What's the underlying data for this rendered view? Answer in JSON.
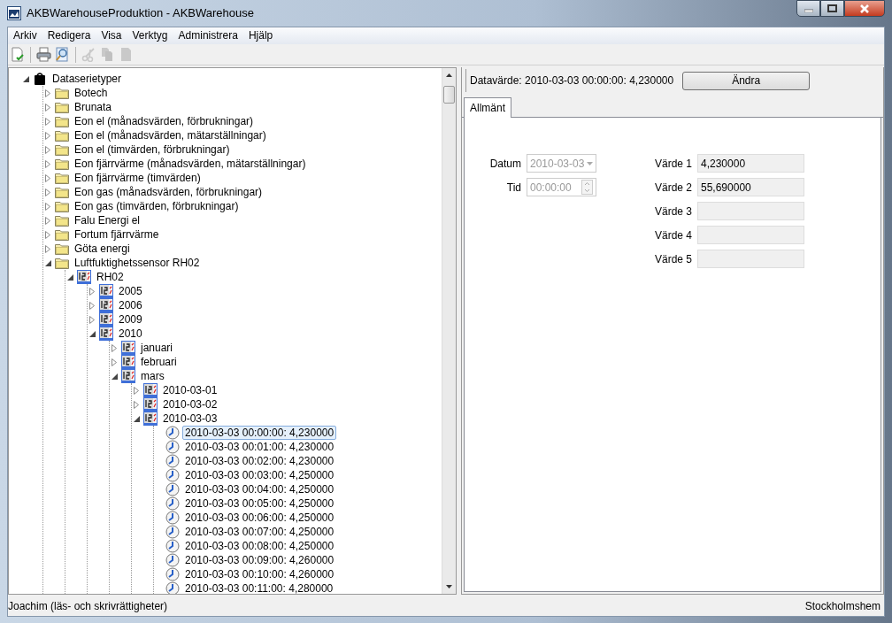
{
  "window": {
    "title": "AKBWarehouseProduktion - AKBWarehouse"
  },
  "menu": [
    "Arkiv",
    "Redigera",
    "Visa",
    "Verktyg",
    "Administrera",
    "Hjälp"
  ],
  "toolbar": [
    {
      "kind": "new",
      "disabled": false
    },
    {
      "kind": "separator"
    },
    {
      "kind": "print",
      "disabled": false
    },
    {
      "kind": "preview",
      "disabled": false
    },
    {
      "kind": "separator"
    },
    {
      "kind": "cut",
      "disabled": true
    },
    {
      "kind": "copy",
      "disabled": true
    },
    {
      "kind": "paste",
      "disabled": true
    }
  ],
  "tree": [
    {
      "label": "Dataserietyper",
      "kind": "root",
      "expanded": true,
      "selected": false,
      "children": [
        {
          "label": "Botech",
          "kind": "folder",
          "expanded": false,
          "selected": false
        },
        {
          "label": "Brunata",
          "kind": "folder",
          "expanded": false,
          "selected": false
        },
        {
          "label": "Eon el (månadsvärden, förbrukningar)",
          "kind": "folder",
          "expanded": false,
          "selected": false
        },
        {
          "label": "Eon el (månadsvärden, mätarställningar)",
          "kind": "folder",
          "expanded": false,
          "selected": false
        },
        {
          "label": "Eon el (timvärden, förbrukningar)",
          "kind": "folder",
          "expanded": false,
          "selected": false
        },
        {
          "label": "Eon fjärrvärme (månadsvärden, mätarställningar)",
          "kind": "folder",
          "expanded": false,
          "selected": false
        },
        {
          "label": "Eon fjärrvärme (timvärden)",
          "kind": "folder",
          "expanded": false,
          "selected": false
        },
        {
          "label": "Eon gas (månadsvärden, förbrukningar)",
          "kind": "folder",
          "expanded": false,
          "selected": false
        },
        {
          "label": "Eon gas (timvärden, förbrukningar)",
          "kind": "folder",
          "expanded": false,
          "selected": false
        },
        {
          "label": "Falu Energi el",
          "kind": "folder",
          "expanded": false,
          "selected": false
        },
        {
          "label": "Fortum fjärrvärme",
          "kind": "folder",
          "expanded": false,
          "selected": false
        },
        {
          "label": "Göta energi",
          "kind": "folder",
          "expanded": false,
          "selected": false
        },
        {
          "label": "Luftfuktighetssensor RH02",
          "kind": "folder",
          "expanded": true,
          "selected": false,
          "children": [
            {
              "label": "RH02",
              "kind": "series",
              "expanded": true,
              "selected": false,
              "children": [
                {
                  "label": "2005",
                  "kind": "series",
                  "expanded": false,
                  "selected": false
                },
                {
                  "label": "2006",
                  "kind": "series",
                  "expanded": false,
                  "selected": false
                },
                {
                  "label": "2009",
                  "kind": "series",
                  "expanded": false,
                  "selected": false
                },
                {
                  "label": "2010",
                  "kind": "series",
                  "expanded": true,
                  "selected": false,
                  "children": [
                    {
                      "label": "januari",
                      "kind": "series",
                      "expanded": false,
                      "selected": false
                    },
                    {
                      "label": "februari",
                      "kind": "series",
                      "expanded": false,
                      "selected": false
                    },
                    {
                      "label": "mars",
                      "kind": "series",
                      "expanded": true,
                      "selected": false,
                      "children": [
                        {
                          "label": "2010-03-01",
                          "kind": "series",
                          "expanded": false,
                          "selected": false
                        },
                        {
                          "label": "2010-03-02",
                          "kind": "series",
                          "expanded": false,
                          "selected": false
                        },
                        {
                          "label": "2010-03-03",
                          "kind": "series",
                          "expanded": true,
                          "selected": false,
                          "children": [
                            {
                              "label": "2010-03-03 00:00:00: 4,230000",
                              "kind": "value",
                              "selected": true
                            },
                            {
                              "label": "2010-03-03 00:01:00: 4,230000",
                              "kind": "value",
                              "selected": false
                            },
                            {
                              "label": "2010-03-03 00:02:00: 4,230000",
                              "kind": "value",
                              "selected": false
                            },
                            {
                              "label": "2010-03-03 00:03:00: 4,250000",
                              "kind": "value",
                              "selected": false
                            },
                            {
                              "label": "2010-03-03 00:04:00: 4,250000",
                              "kind": "value",
                              "selected": false
                            },
                            {
                              "label": "2010-03-03 00:05:00: 4,250000",
                              "kind": "value",
                              "selected": false
                            },
                            {
                              "label": "2010-03-03 00:06:00: 4,250000",
                              "kind": "value",
                              "selected": false
                            },
                            {
                              "label": "2010-03-03 00:07:00: 4,250000",
                              "kind": "value",
                              "selected": false
                            },
                            {
                              "label": "2010-03-03 00:08:00: 4,250000",
                              "kind": "value",
                              "selected": false
                            },
                            {
                              "label": "2010-03-03 00:09:00: 4,260000",
                              "kind": "value",
                              "selected": false
                            },
                            {
                              "label": "2010-03-03 00:10:00: 4,260000",
                              "kind": "value",
                              "selected": false
                            },
                            {
                              "label": "2010-03-03 00:11:00: 4,280000",
                              "kind": "value",
                              "selected": false
                            }
                          ]
                        }
                      ]
                    }
                  ]
                }
              ]
            }
          ]
        }
      ]
    }
  ],
  "detail": {
    "header": "Datavärde: 2010-03-03 00:00:00: 4,230000",
    "button": "Ändra",
    "tabs": [
      {
        "label": "Allmänt",
        "selected": true
      }
    ],
    "date": {
      "label": "Datum",
      "value": "2010-03-03",
      "disabled": true
    },
    "time": {
      "label": "Tid",
      "value": "00:00:00",
      "disabled": true
    },
    "values": [
      {
        "label": "Värde 1",
        "value": "4,230000"
      },
      {
        "label": "Värde 2",
        "value": "55,690000"
      },
      {
        "label": "Värde 3"
      },
      {
        "label": "Värde 4"
      },
      {
        "label": "Värde 5"
      }
    ]
  },
  "status_bar": {
    "user": "Joachim (läs- och skrivrättigheter)",
    "company": "Stockholmshem"
  }
}
